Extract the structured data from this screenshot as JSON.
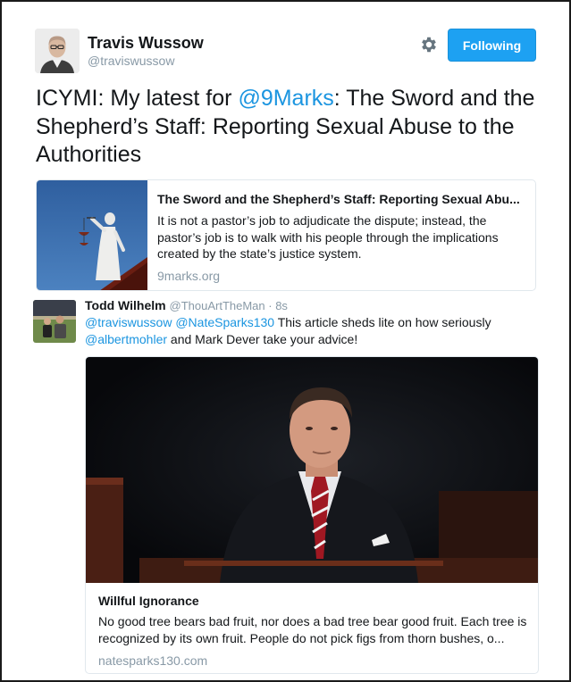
{
  "author": {
    "name": "Travis Wussow",
    "handle": "@traviswussow"
  },
  "follow_button": {
    "label": "Following"
  },
  "tweet": {
    "prefix": "ICYMI: My latest for ",
    "mention": "@9Marks",
    "suffix": ": The Sword and the Shepherd’s Staff: Reporting Sexual Abuse to the Authorities"
  },
  "card1": {
    "title": "The Sword and the Shepherd’s Staff: Reporting Sexual Abu...",
    "description": "It is not a pastor’s job to adjudicate the dispute; instead, the pastor’s job is to walk with his people through the implications created by the state’s justice system.",
    "domain": "9marks.org"
  },
  "reply": {
    "name": "Todd Wilhelm",
    "handle": "@ThouArtTheMan",
    "separator": " · ",
    "time": "8s",
    "mention1": "@traviswussow",
    "mention2": "@NateSparks130",
    "text1": " This article sheds lite on how seriously ",
    "mention3": "@albertmohler",
    "text2": " and Mark Dever take your advice!"
  },
  "card2": {
    "title": "Willful Ignorance",
    "description": "No good tree bears bad fruit, nor does a bad tree bear good fruit. Each tree is recognized by its own fruit. People do not pick figs from thorn bushes, o...",
    "domain": "natesparks130.com"
  },
  "colors": {
    "accent": "#1da1f2",
    "link": "#1b95e0",
    "muted": "#8899a6",
    "text": "#14171a",
    "border": "#e1e8ed"
  },
  "icons": [
    "gear-icon"
  ]
}
